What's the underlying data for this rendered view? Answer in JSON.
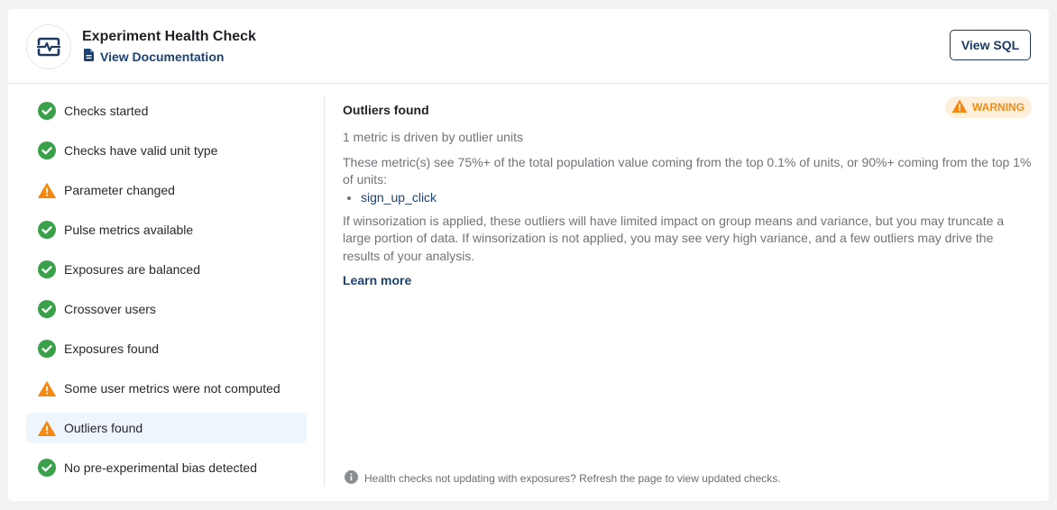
{
  "header": {
    "title": "Experiment Health Check",
    "doc_link": "View Documentation",
    "view_sql": "View SQL"
  },
  "checks": [
    {
      "label": "Checks started",
      "status": "pass"
    },
    {
      "label": "Checks have valid unit type",
      "status": "pass"
    },
    {
      "label": "Parameter changed",
      "status": "warning"
    },
    {
      "label": "Pulse metrics available",
      "status": "pass"
    },
    {
      "label": "Exposures are balanced",
      "status": "pass"
    },
    {
      "label": "Crossover users",
      "status": "pass"
    },
    {
      "label": "Exposures found",
      "status": "pass"
    },
    {
      "label": "Some user metrics were not computed",
      "status": "warning"
    },
    {
      "label": "Outliers found",
      "status": "warning",
      "selected": true
    },
    {
      "label": "No pre-experimental bias detected",
      "status": "pass"
    }
  ],
  "detail": {
    "title": "Outliers found",
    "badge": "WARNING",
    "summary": "1 metric is driven by outlier units",
    "description": "These metric(s) see 75%+ of the total population value coming from the top 0.1% of units, or 90%+ coming from the top 1% of units:",
    "metrics": [
      "sign_up_click"
    ],
    "explanation": "If winsorization is applied, these outliers will have limited impact on group means and variance, but you may truncate a large portion of data. If winsorization is not applied, you may see very high variance, and a few outliers may drive the results of your analysis.",
    "learn_more": "Learn more"
  },
  "footer_note": "Health checks not updating with exposures? Refresh the page to view updated checks.",
  "colors": {
    "pass": "#3aa14a",
    "warning": "#f5880f",
    "link": "#1c4273",
    "selected_bg": "#eff5fc"
  }
}
